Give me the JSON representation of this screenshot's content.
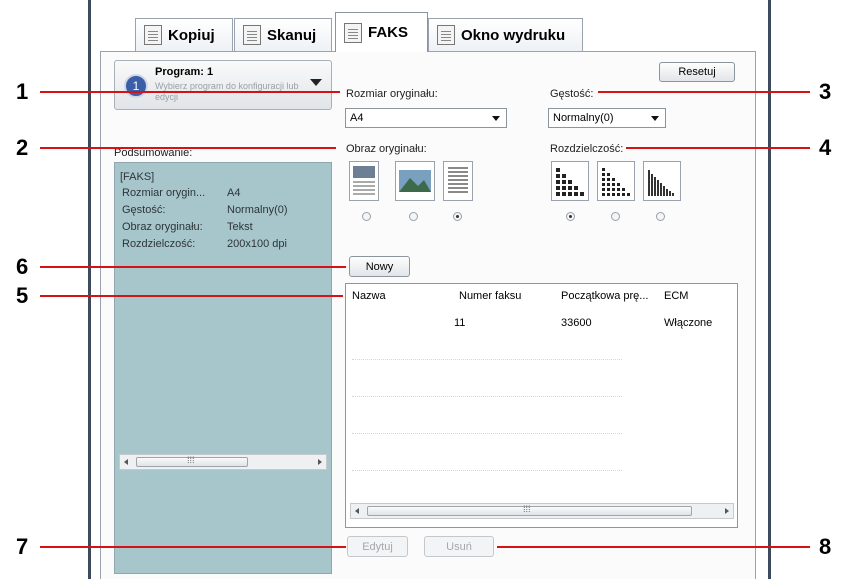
{
  "tabs": [
    {
      "label": "Kopiuj"
    },
    {
      "label": "Skanuj"
    },
    {
      "label": "FAKS"
    },
    {
      "label": "Okno wydruku"
    }
  ],
  "program": {
    "number": "1",
    "title": "Program: 1",
    "subtitle": "Wybierz program do konfiguracji lub edycji"
  },
  "reset_label": "Resetuj",
  "original_size": {
    "label": "Rozmiar oryginału:",
    "value": "A4"
  },
  "density": {
    "label": "Gęstość:",
    "value": "Normalny(0)"
  },
  "original_image": {
    "label": "Obraz oryginału:"
  },
  "resolution": {
    "label": "Rozdzielczość:"
  },
  "summary": {
    "label": "Podsumowanie:",
    "header": "[FAKS]",
    "rows": [
      {
        "key": "Rozmiar orygin...",
        "value": "A4"
      },
      {
        "key": "Gęstość:",
        "value": "Normalny(0)"
      },
      {
        "key": "Obraz oryginału:",
        "value": "Tekst"
      },
      {
        "key": "Rozdzielczość:",
        "value": "200x100 dpi"
      }
    ]
  },
  "new_label": "Nowy",
  "list": {
    "columns": [
      "Nazwa",
      "Numer faksu",
      "Początkowa prę...",
      "ECM"
    ],
    "rows": [
      {
        "name": "",
        "fax": "11",
        "speed": "33600",
        "ecm": "Włączone"
      }
    ]
  },
  "edit_label": "Edytuj",
  "delete_label": "Usuń",
  "callouts": [
    "1",
    "2",
    "3",
    "4",
    "5",
    "6",
    "7",
    "8"
  ],
  "colors": {
    "callout_line": "#d51317",
    "summary_bg": "#a7c6cc",
    "accent": "#3a5fa8"
  }
}
